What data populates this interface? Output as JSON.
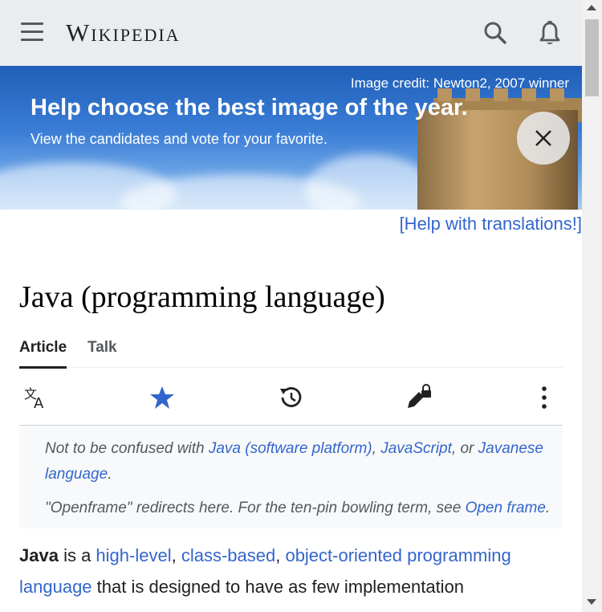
{
  "header": {
    "logo_text": "Wikipedia",
    "icons": [
      "menu-icon",
      "search-icon",
      "bell-icon"
    ]
  },
  "banner": {
    "credit": "Image credit: Newton2, 2007 winner",
    "title": "Help choose the best image of the year.",
    "subtitle": "View the candidates and vote for your favorite.",
    "help_link": "[Help with translations!]"
  },
  "article": {
    "title": "Java (programming language)",
    "tabs": [
      {
        "label": "Article",
        "active": true
      },
      {
        "label": "Talk",
        "active": false
      }
    ],
    "actions": [
      "language-icon",
      "star-icon",
      "history-icon",
      "edit-lock-icon",
      "more-icon"
    ]
  },
  "hatnote": {
    "line1_prefix": "Not to be confused with ",
    "link1": "Java (software platform)",
    "sep1": ", ",
    "link2": "JavaScript",
    "sep2": ", or ",
    "link3": "Javanese language",
    "end1": ".",
    "line2_prefix": "\"Openframe\" redirects here. For the ten-pin bowling term, see ",
    "link4": "Open frame",
    "end2": "."
  },
  "body": {
    "bold": "Java",
    "t1": " is a ",
    "l1": "high-level",
    "t2": ", ",
    "l2": "class-based",
    "t3": ", ",
    "l3": "object-oriented programming language",
    "t4": " that is designed to have as few implementation"
  },
  "colors": {
    "link": "#3366cc",
    "header_bg": "#eaecf0",
    "star": "#3366cc"
  }
}
